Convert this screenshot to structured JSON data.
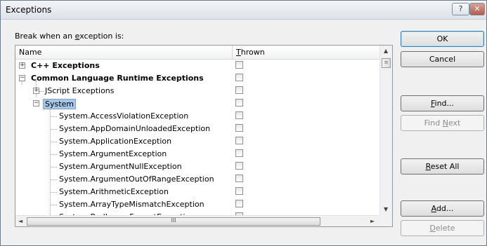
{
  "window": {
    "title": "Exceptions",
    "help_label": "?",
    "close_label": "✕"
  },
  "prompt": {
    "pre": "Break when an ",
    "ul": "e",
    "post": "xception is:"
  },
  "columns": {
    "name": "Name",
    "thrown_ul": "T",
    "thrown_rest": "hrown"
  },
  "rows": [
    {
      "label": "C++ Exceptions",
      "bold": true
    },
    {
      "label": "Common Language Runtime Exceptions",
      "bold": true
    },
    {
      "label": "JScript Exceptions",
      "bold": false
    },
    {
      "label": "System",
      "bold": false,
      "selected": true
    },
    {
      "label": "System.AccessViolationException"
    },
    {
      "label": "System.AppDomainUnloadedException"
    },
    {
      "label": "System.ApplicationException"
    },
    {
      "label": "System.ArgumentException"
    },
    {
      "label": "System.ArgumentNullException"
    },
    {
      "label": "System.ArgumentOutOfRangeException"
    },
    {
      "label": "System.ArithmeticException"
    },
    {
      "label": "System.ArrayTypeMismatchException"
    },
    {
      "label": "System.BadImageFormatException"
    }
  ],
  "scroll": {
    "hthumb_grip": "III",
    "vthumb_grip": "≡"
  },
  "buttons": {
    "ok": "OK",
    "cancel": "Cancel",
    "find_ul": "F",
    "find_rest": "ind...",
    "findnext_pre": "Find ",
    "findnext_ul": "N",
    "findnext_rest": "ext",
    "reset_ul": "R",
    "reset_rest": "eset All",
    "add_ul": "A",
    "add_rest": "dd...",
    "delete_ul": "D",
    "delete_rest": "elete"
  }
}
